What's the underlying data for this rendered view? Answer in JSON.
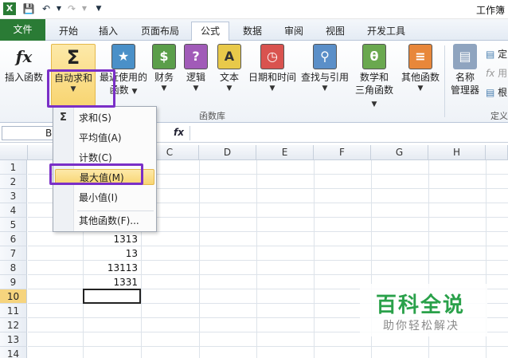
{
  "title_partial": "工作簿",
  "tabs": {
    "file": "文件",
    "home": "开始",
    "insert": "插入",
    "layout": "页面布局",
    "formula": "公式",
    "data": "数据",
    "review": "审阅",
    "view": "视图",
    "developer": "开发工具"
  },
  "ribbon": {
    "insert_function": "插入函数",
    "autosum": "自动求和",
    "recent_line1": "最近使用的",
    "recent_line2": "函数",
    "financial": "财务",
    "logical": "逻辑",
    "text": "文本",
    "datetime": "日期和时间",
    "lookup": "查找与引用",
    "math_line1": "数学和",
    "math_line2": "三角函数",
    "other": "其他函数",
    "name_mgr_line1": "名称",
    "name_mgr_line2": "管理器",
    "define_partial": "定",
    "use_partial": "用",
    "from_partial": "根",
    "group_label": "函数库",
    "group_label2": "定义"
  },
  "formula_bar": {
    "name_box": "B",
    "fx": "fx"
  },
  "columns": [
    "C",
    "D",
    "E",
    "F",
    "G",
    "H"
  ],
  "rows": [
    "1",
    "2",
    "3",
    "4",
    "5",
    "6",
    "7",
    "8",
    "9",
    "10",
    "11",
    "12",
    "13",
    "14"
  ],
  "selected_row": "10",
  "cells": {
    "b6": "1313",
    "b7": "13",
    "b8": "13113",
    "b9": "1331"
  },
  "menu": {
    "sum": "求和(S)",
    "average": "平均值(A)",
    "count": "计数(C)",
    "max": "最大值(M)",
    "min": "最小值(I)",
    "more": "其他函数(F)..."
  },
  "watermark": {
    "main": "百科全说",
    "sub": "助你轻松解决"
  },
  "colors": {
    "file_tab": "#2a7b35",
    "highlight_box": "#7a2fc7",
    "menu_hover": "#f8d572",
    "watermark_green": "#2aa14a"
  }
}
